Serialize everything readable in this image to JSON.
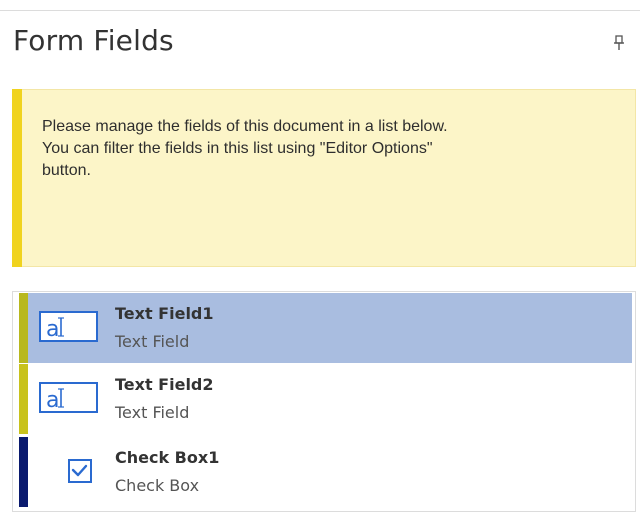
{
  "panel": {
    "title": "Form Fields",
    "pin_icon": "pin-icon"
  },
  "info": {
    "line1": "Please manage the fields of this document in a list below.",
    "line2": "You can filter the fields in this list using \"Editor Options\"",
    "line3": "button.",
    "accent_color": "#f0d31e",
    "background_color": "#fcf5c8"
  },
  "fields": [
    {
      "name": "Text Field1",
      "type": "Text Field",
      "icon": "text-field-icon",
      "selected": true,
      "stripe_color": "#b8b81e"
    },
    {
      "name": "Text Field2",
      "type": "Text Field",
      "icon": "text-field-icon",
      "selected": false,
      "stripe_color": "#c8c21c"
    },
    {
      "name": "Check Box1",
      "type": "Check Box",
      "icon": "check-box-icon",
      "selected": false,
      "stripe_color": "#0a1a6e"
    }
  ],
  "colors": {
    "selection": "#a9bde0",
    "icon_blue": "#2a6ad0"
  }
}
